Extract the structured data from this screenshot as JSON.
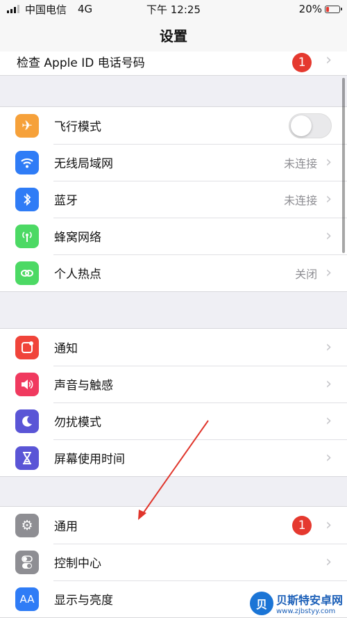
{
  "status_bar": {
    "carrier": "中国电信",
    "network": "4G",
    "time": "下午 12:25",
    "battery_percent": "20%",
    "battery_level": 0.2
  },
  "nav": {
    "title": "设置"
  },
  "top_row": {
    "label": "检查 Apple ID 电话号码",
    "badge": "1"
  },
  "group1": [
    {
      "label": "飞行模式",
      "icon": "airplane-icon",
      "color": "#f6a13a",
      "control": "toggle",
      "toggle_on": false
    },
    {
      "label": "无线局域网",
      "icon": "wifi-icon",
      "color": "#2f7cf6",
      "value": "未连接"
    },
    {
      "label": "蓝牙",
      "icon": "bluetooth-icon",
      "color": "#2f7cf6",
      "value": "未连接"
    },
    {
      "label": "蜂窝网络",
      "icon": "cellular-icon",
      "color": "#4cd964",
      "value": ""
    },
    {
      "label": "个人热点",
      "icon": "hotspot-icon",
      "color": "#4cd964",
      "value": "关闭"
    }
  ],
  "group2": [
    {
      "label": "通知",
      "icon": "notifications-icon",
      "color": "#f0443a"
    },
    {
      "label": "声音与触感",
      "icon": "sounds-icon",
      "color": "#f03a5f"
    },
    {
      "label": "勿扰模式",
      "icon": "moon-icon",
      "color": "#5a55d6"
    },
    {
      "label": "屏幕使用时间",
      "icon": "hourglass-icon",
      "color": "#5a55d6"
    }
  ],
  "group3": [
    {
      "label": "通用",
      "icon": "gear-icon",
      "color": "#8e8e93",
      "badge": "1"
    },
    {
      "label": "控制中心",
      "icon": "switches-icon",
      "color": "#8e8e93"
    },
    {
      "label": "显示与亮度",
      "icon": "display-icon",
      "color": "#2f7cf6",
      "glyph": "AA"
    }
  ],
  "watermark": {
    "title": "贝斯特安卓网",
    "url": "www.zjbstyy.com"
  },
  "annotation": {
    "color": "#e0352b"
  }
}
